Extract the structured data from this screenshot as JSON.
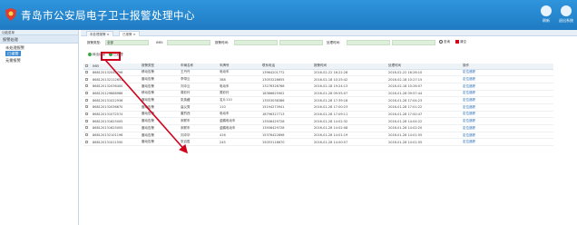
{
  "header": {
    "title": "青岛市公安局电子卫士报警处理中心",
    "actions": [
      {
        "label": "刷新"
      },
      {
        "label": "退出系统"
      }
    ]
  },
  "sidebar": {
    "head": "功能菜单",
    "group": "报警处理",
    "items": [
      {
        "label": "未处理报警",
        "active": false
      },
      {
        "label": "已报警",
        "active": true
      },
      {
        "label": "无需报警",
        "active": false
      }
    ]
  },
  "tabs": [
    {
      "label": "未处理报警 ×",
      "active": false
    },
    {
      "label": "已报警 ×",
      "active": true
    }
  ],
  "filter": {
    "type_label": "报警类型:",
    "type_value": "全部",
    "imei_label": "IMEI:",
    "alarm_time_label": "报警时间:",
    "handle_time_label": "处理时间:",
    "search_label": "查询",
    "clear_label": "清空"
  },
  "toolbar": {
    "tool1": "转出记录",
    "tool2": "已处理"
  },
  "table": {
    "headers": [
      "",
      "IMEI",
      "报警类型",
      "车辆名称",
      "车牌号",
      "联系电话",
      "报警时间",
      "处理时间",
      "操作"
    ],
    "rows": [
      [
        "",
        "868120132045796",
        "移动告警",
        "王丹丹",
        "电动车",
        "13964201772",
        "2016-02-22 16:22:28",
        "2016-02-22 16:26:10",
        "定位追踪"
      ],
      [
        "",
        "868120132112651",
        "震动告警",
        "李带云",
        "388",
        "13053228655",
        "2016-02-18 10:25:42",
        "2016-02-18 10:27:15",
        "定位追踪"
      ],
      [
        "",
        "868120132036400",
        "震动告警",
        "刘冲云",
        "电动车",
        "13276326768",
        "2016-02-18 19:24:13",
        "2016-02-18 10:26:07",
        "定位追踪"
      ],
      [
        "",
        "868120129888986",
        "移动告警",
        "周彩玲",
        "周彩玲",
        "18366625902",
        "2016-01-28 09:55:07",
        "2016-01-28 09:57:44",
        "定位追踪"
      ],
      [
        "",
        "868120131022936",
        "震动告警",
        "张英藏",
        "名片110",
        "13553038386",
        "2016-01-28 17:39:18",
        "2016-01-28 17:04:23",
        "定位追踪"
      ],
      [
        "",
        "868120132036670",
        "震动告警",
        "高父秀",
        "110",
        "15194273941",
        "2016-01-28 17:00:23",
        "2016-01-28 17:01:22",
        "定位追踪"
      ],
      [
        "",
        "868120131072574",
        "震动告警",
        "董烈西",
        "电动车",
        "18796327713",
        "2016-01-28 17:09:11",
        "2016-01-28 17:00:47",
        "定位追踪"
      ],
      [
        "",
        "868120131625005",
        "震动告警",
        "宋联车",
        "金鹏电动车",
        "13506429728",
        "2016-01-28 14:02:32",
        "2016-01-28 14:04:22",
        "定位追踪"
      ],
      [
        "",
        "868120131625005",
        "震动告警",
        "宋联车",
        "金鹏电动车",
        "13506429728",
        "2016-01-28 14:02:08",
        "2016-01-28 14:02:20",
        "定位追踪"
      ],
      [
        "",
        "868120132101196",
        "震动告警",
        "刘冲华",
        "416",
        "15376422898",
        "2016-01-28 14:01:19",
        "2016-01-28 14:01:55",
        "定位追踪"
      ],
      [
        "",
        "868120131011550",
        "震动告警",
        "张百胜",
        "245",
        "15053116670",
        "2016-01-28 14:00:57",
        "2016-01-28 14:01:55",
        "定位追踪"
      ]
    ]
  },
  "colors": {
    "header": "#2f95dc",
    "accent": "#3a8ad4",
    "highlight": "#d0021b"
  }
}
